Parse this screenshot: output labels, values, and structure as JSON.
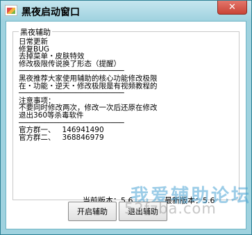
{
  "window": {
    "title": "黑夜启动窗口",
    "close_label": "✕"
  },
  "group": {
    "title": "黑夜辅助",
    "notes": "日常更新\n修复BUG\n去掉菜单・皮肤特效\n修改极限传说换了形态（提醒）\n────────────────────────\n黑夜推荐大家使用辅助的核心功能修改极限\n在・功能・逆天・修改极限是有视频教程的\n────────────────────────\n注意事项：\n不要同时修改两次，修改一次后还原在修改\n退出360等杀毒软件\n────────────────────────\n官方群一、   146941490\n官方群二、   368846979"
  },
  "version": {
    "current": "当前版本：5.6",
    "latest": "最新版本：5.6"
  },
  "buttons": {
    "start": "开启辅助",
    "exit": "退出辅助"
  },
  "watermark": {
    "text": "我爱辅助论坛",
    "url": "52fzba.com"
  }
}
